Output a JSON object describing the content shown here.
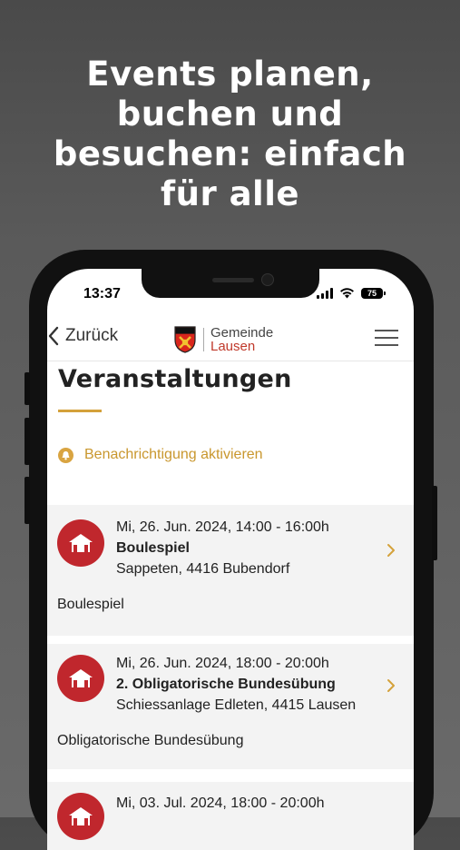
{
  "headline": {
    "line1": "Events planen,",
    "line2": "buchen und",
    "line3": "besuchen: einfach",
    "line4": "für alle"
  },
  "status_bar": {
    "time": "13:37",
    "battery": "75"
  },
  "nav": {
    "back_label": "Zurück",
    "logo_top": "Gemeinde",
    "logo_bottom": "Lausen",
    "menu_icon": "hamburger-menu-icon"
  },
  "page": {
    "title": "Veranstaltungen",
    "notify_label": "Benachrichtigung aktivieren",
    "accent_color": "#d4a13a"
  },
  "events": [
    {
      "datetime": "Mi, 26. Jun. 2024, 14:00 - 16:00h",
      "name": "Boulespiel",
      "location": "Sappeten, 4416 Bubendorf",
      "description": "Boulespiel",
      "icon": "event-venue-icon"
    },
    {
      "datetime": "Mi, 26. Jun. 2024, 18:00 - 20:00h",
      "name": "2. Obligatorische Bundesübung",
      "location": "Schiessanlage Edleten, 4415 Lausen",
      "description": "Obligatorische Bundesübung",
      "icon": "event-venue-icon"
    },
    {
      "datetime": "Mi, 03. Jul. 2024, 18:00 - 20:00h",
      "icon": "event-venue-icon"
    }
  ],
  "colors": {
    "brand_red": "#c0272d",
    "accent_gold": "#d4a13a"
  }
}
